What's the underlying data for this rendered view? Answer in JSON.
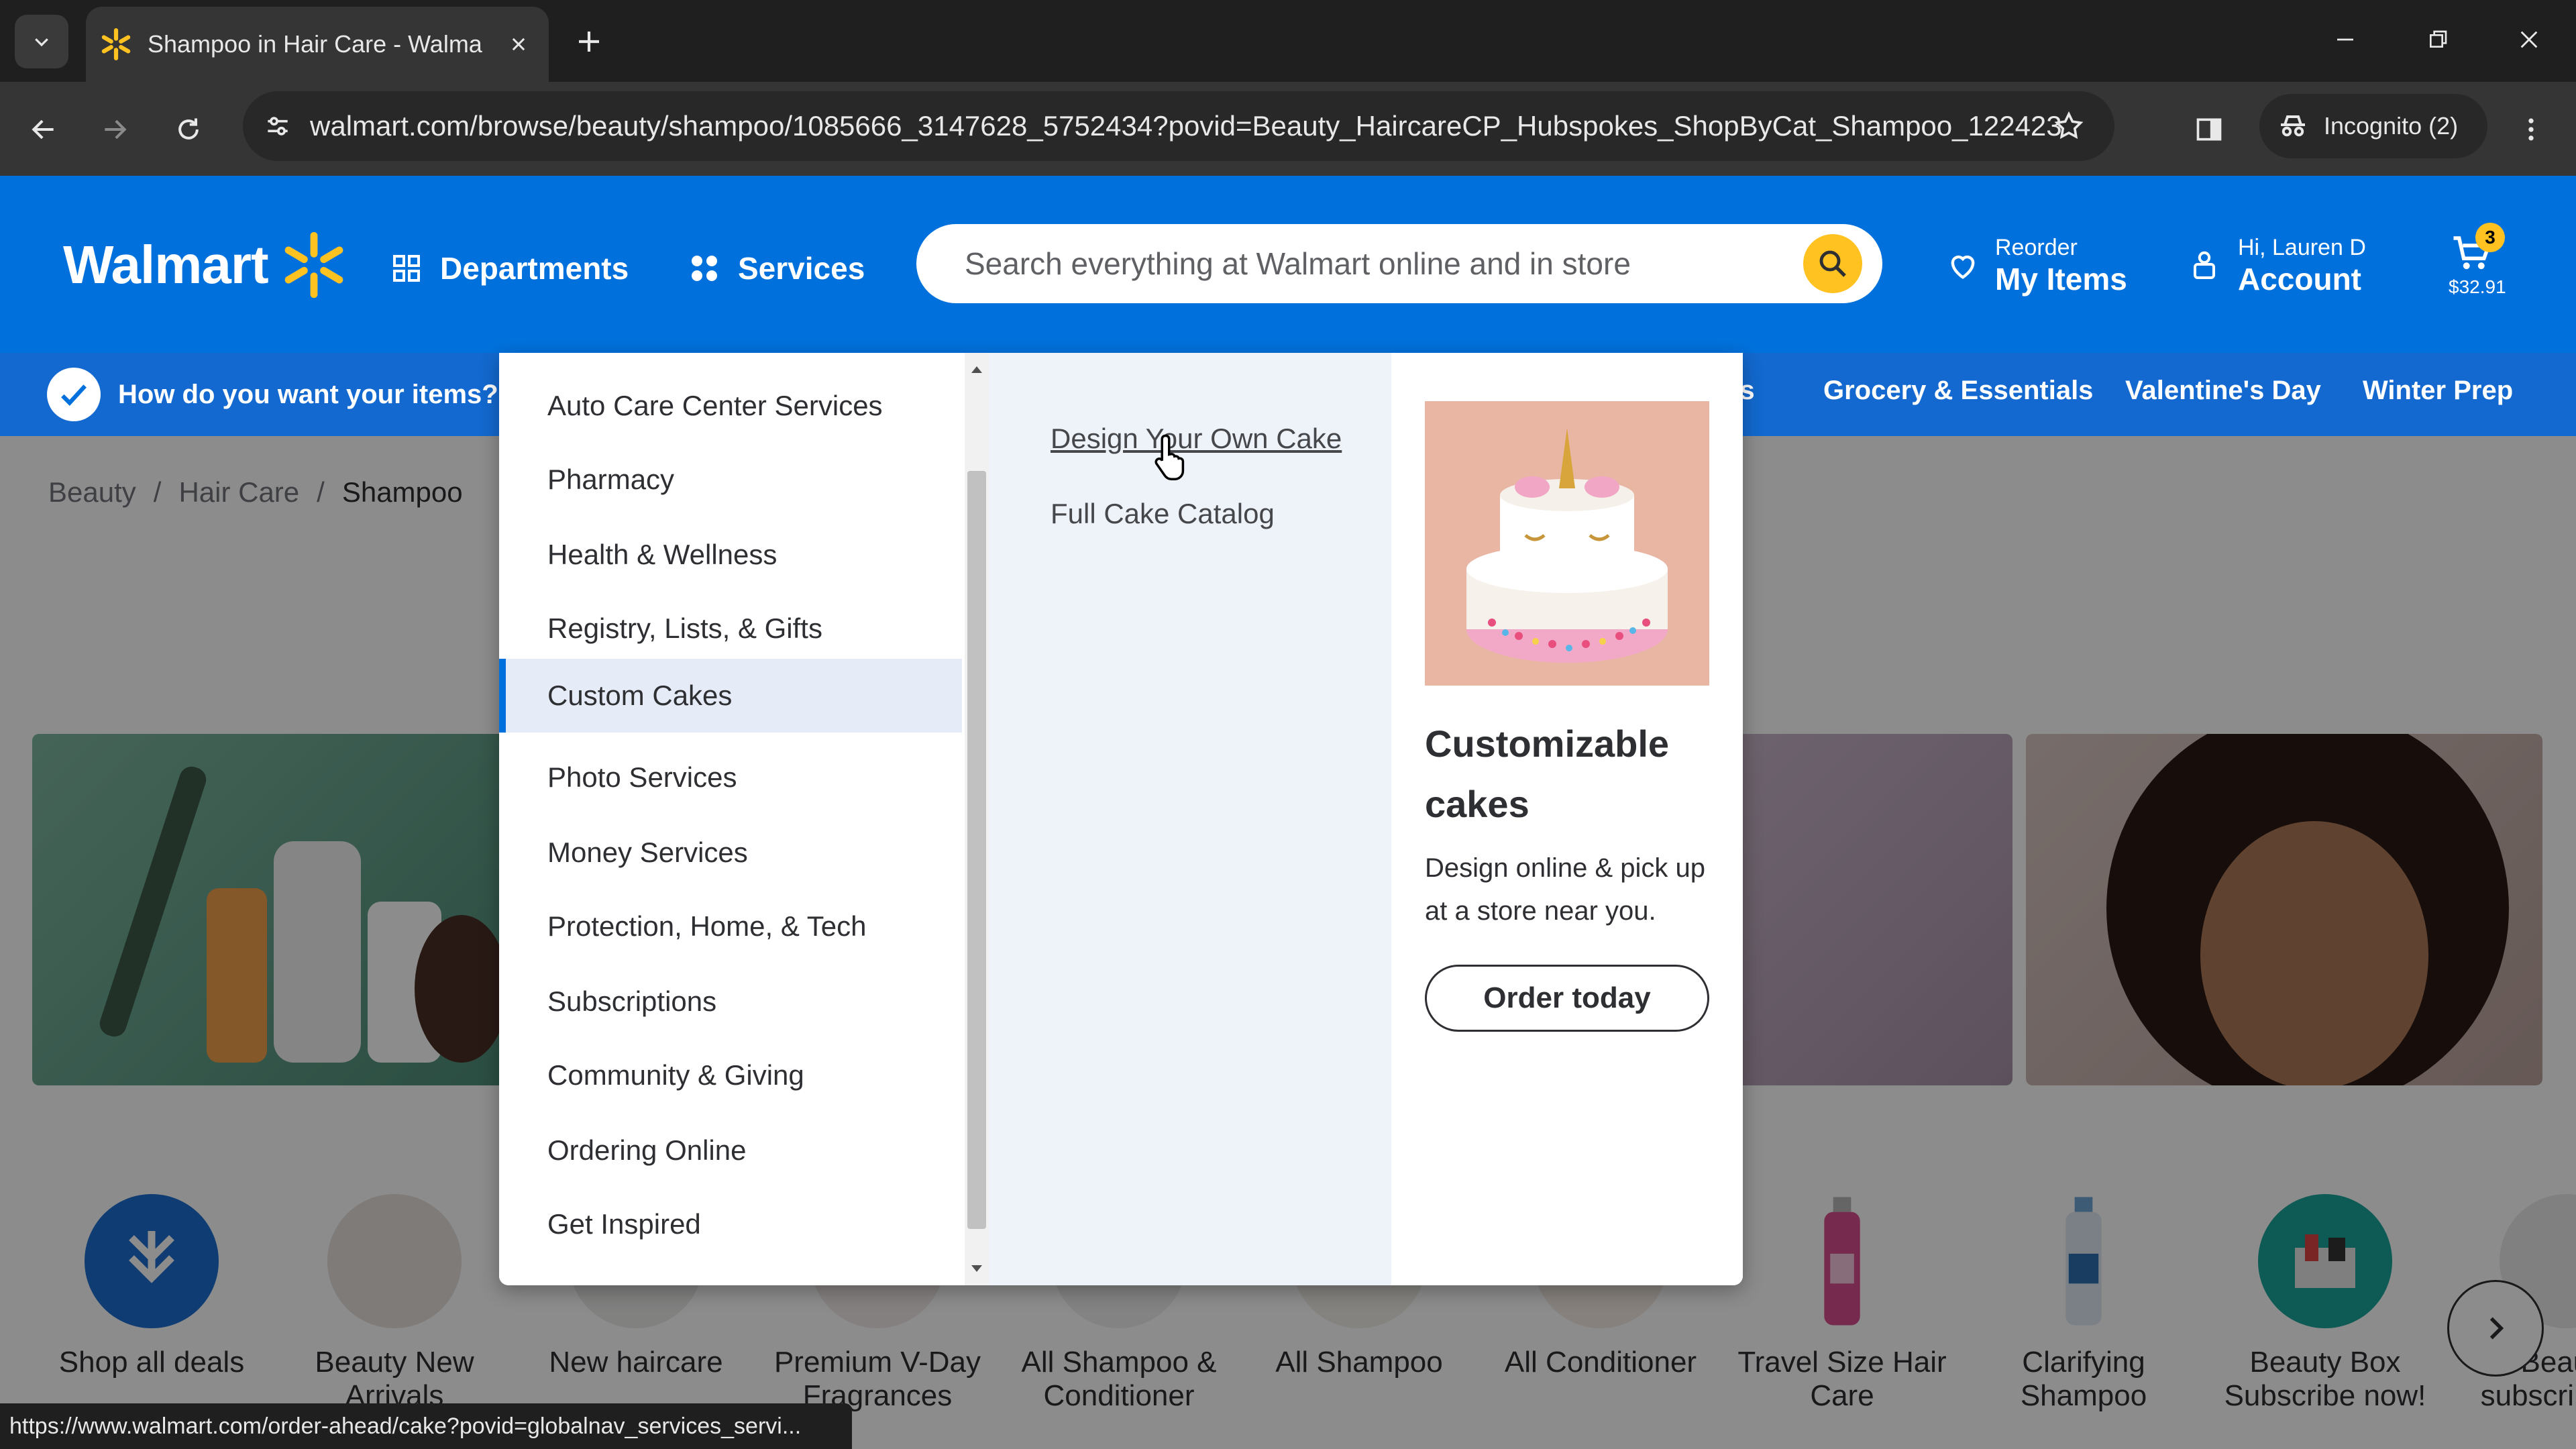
{
  "browser": {
    "tab_title": "Shampoo in Hair Care - Walmart",
    "url": "walmart.com/browse/beauty/shampoo/1085666_3147628_5752434?povid=Beauty_HaircareCP_Hubspokes_ShopByCat_Shampoo_122423",
    "incognito_label": "Incognito (2)",
    "status_url": "https://www.walmart.com/order-ahead/cake?povid=globalnav_services_servi..."
  },
  "header": {
    "logo_text": "Walmart",
    "departments_label": "Departments",
    "services_label": "Services",
    "search_placeholder": "Search everything at Walmart online and in store",
    "reorder_small": "Reorder",
    "reorder_big": "My Items",
    "account_small": "Hi, Lauren D",
    "account_big": "Account",
    "cart_count": "3",
    "cart_total": "$32.91",
    "brand_color": "#0071dc",
    "spark_color": "#ffc220"
  },
  "subnav": {
    "how_label": "How do you want your items?",
    "items": [
      "als",
      "Grocery & Essentials",
      "Valentine's Day",
      "Winter Prep"
    ]
  },
  "breadcrumb": [
    "Beauty",
    "Hair Care",
    "Shampoo"
  ],
  "services_menu": {
    "items": [
      "Auto Care Center Services",
      "Pharmacy",
      "Health & Wellness",
      "Registry, Lists, & Gifts",
      "Custom Cakes",
      "Photo Services",
      "Money Services",
      "Protection, Home, & Tech",
      "Subscriptions",
      "Community & Giving",
      "Ordering Online",
      "Get Inspired"
    ],
    "active_item": "Custom Cakes",
    "sub_links": [
      "Design Your Own Cake",
      "Full Cake Catalog"
    ],
    "promo": {
      "title": "Customizable cakes",
      "description": "Design online & pick up at a store near you.",
      "button": "Order today"
    }
  },
  "categories": [
    "Shop all deals",
    "Beauty New Arrivals",
    "New haircare",
    "Premium V-Day Fragrances",
    "All Shampoo & Conditioner",
    "All Shampoo",
    "All Conditioner",
    "Travel Size Hair Care",
    "Clarifying Shampoo",
    "Beauty Box Subscribe now!",
    "Beauty subscriptions"
  ]
}
